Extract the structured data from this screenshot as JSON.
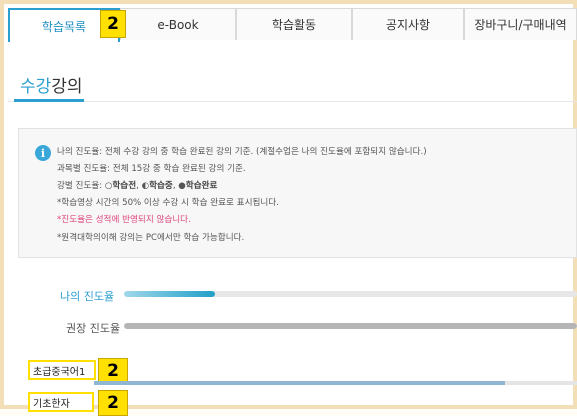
{
  "tabs": [
    {
      "label": "학습목록"
    },
    {
      "label": "e-Book"
    },
    {
      "label": "학습활동"
    },
    {
      "label": "공지사항"
    },
    {
      "label": "장바구니/구매내역"
    }
  ],
  "badges": {
    "tab": "2",
    "course1": "2",
    "course2": "2"
  },
  "section": {
    "title_accent": "수강",
    "title_rest": "강의"
  },
  "info": {
    "line1": "나의 진도율: 전체 수강 강의 중 학습 완료된 강의 기준. (계절수업은 나의 진도율에 포함되지 않습니다.)",
    "line2": "과목별 진도율: 전체 15강 중 학습 완료된 강의 기준.",
    "line3_prefix": "강별 진도율: ○",
    "line3_a": "학습전",
    "line3_sep1": ", ◐",
    "line3_b": "학습중",
    "line3_sep2": ", ●",
    "line3_c": "학습완료",
    "line4": "*학습영상 시간의 50% 이상 수강 시 학습 완료로 표시됩니다.",
    "line5": "*진도율은 성적에 반영되지 않습니다.",
    "line6": "*원격대학의이해 강의는 PC에서만 학습 가능합니다."
  },
  "progress": {
    "my_label": "나의 진도율",
    "my_value": 0.2,
    "recommended_label": "권장 진도율",
    "recommended_value": 1.0
  },
  "courses": [
    {
      "name": "초급중국어1",
      "progress": 0.85
    },
    {
      "name": "기초한자"
    }
  ],
  "colors": {
    "accent": "#2b9fd0",
    "highlight": "#ffe000",
    "warning_text": "#e0447d"
  }
}
